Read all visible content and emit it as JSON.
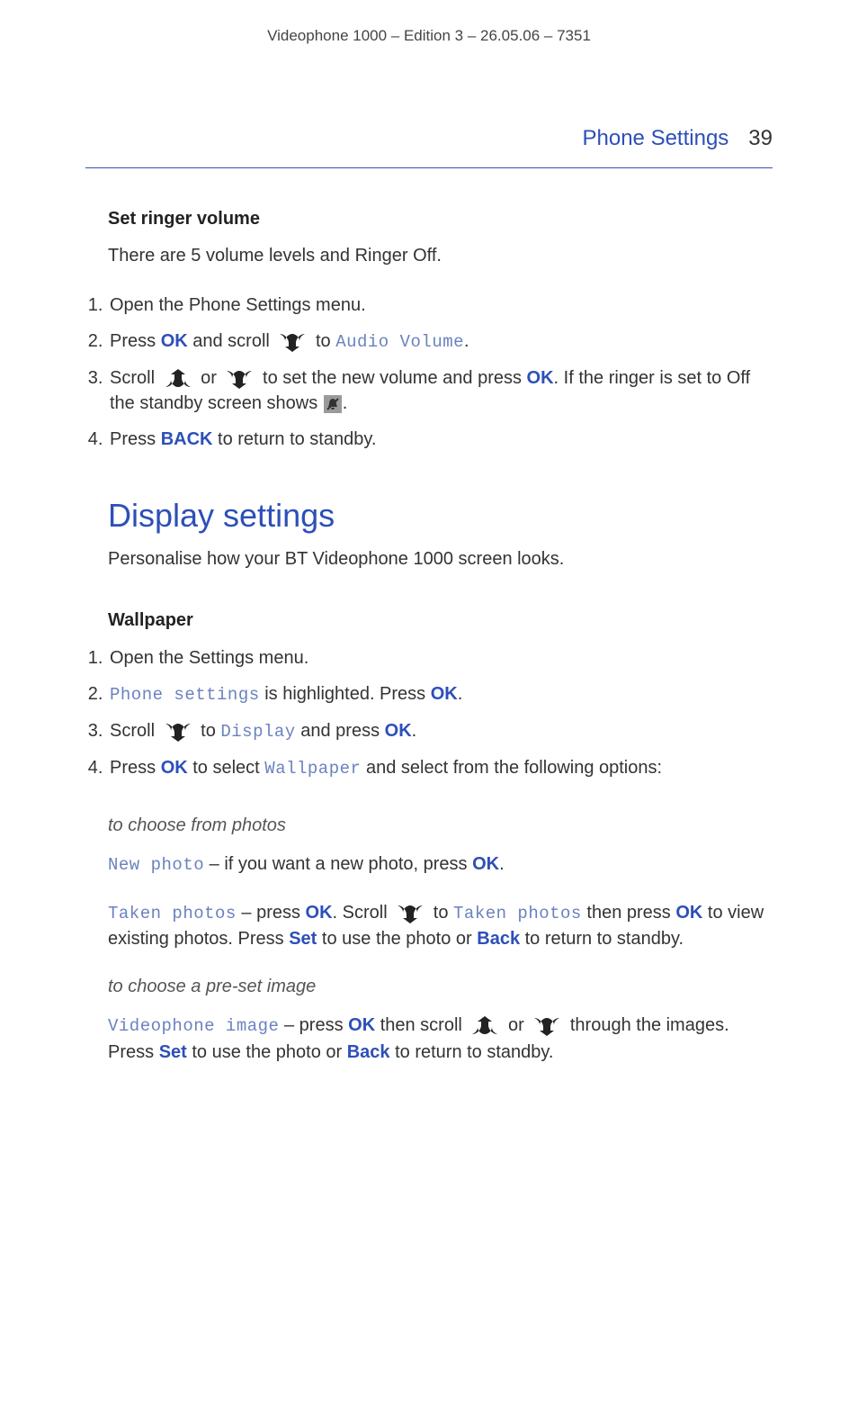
{
  "header": "Videophone 1000 – Edition 3 – 26.05.06 – 7351",
  "sectionHeader": {
    "title": "Phone Settings",
    "pageNum": "39"
  },
  "s1": {
    "heading": "Set ringer volume",
    "intro": "There are 5 volume levels and Ringer Off.",
    "steps": [
      {
        "parts": [
          {
            "t": "text",
            "v": "Open the Phone Settings menu."
          }
        ]
      },
      {
        "parts": [
          {
            "t": "text",
            "v": "Press "
          },
          {
            "t": "bb",
            "v": "OK"
          },
          {
            "t": "text",
            "v": " and scroll "
          },
          {
            "t": "icon",
            "v": "down"
          },
          {
            "t": "text",
            "v": " to "
          },
          {
            "t": "lcd",
            "v": "Audio Volume"
          },
          {
            "t": "text",
            "v": "."
          }
        ]
      },
      {
        "parts": [
          {
            "t": "text",
            "v": "Scroll "
          },
          {
            "t": "icon",
            "v": "up"
          },
          {
            "t": "text",
            "v": " or "
          },
          {
            "t": "icon",
            "v": "down"
          },
          {
            "t": "text",
            "v": " to set the new volume and press "
          },
          {
            "t": "bb",
            "v": "OK"
          },
          {
            "t": "text",
            "v": ". If the ringer is set to Off the standby screen shows "
          },
          {
            "t": "icon",
            "v": "mute"
          },
          {
            "t": "text",
            "v": "."
          }
        ]
      },
      {
        "parts": [
          {
            "t": "text",
            "v": "Press "
          },
          {
            "t": "bb",
            "v": "BACK"
          },
          {
            "t": "text",
            "v": " to return to standby."
          }
        ]
      }
    ]
  },
  "s2": {
    "h2": "Display settings",
    "intro": "Personalise how your BT Videophone 1000 screen looks.",
    "heading": "Wallpaper",
    "steps": [
      {
        "parts": [
          {
            "t": "text",
            "v": "Open the Settings menu."
          }
        ]
      },
      {
        "parts": [
          {
            "t": "lcd",
            "v": "Phone settings"
          },
          {
            "t": "text",
            "v": " is highlighted. Press "
          },
          {
            "t": "bb",
            "v": "OK"
          },
          {
            "t": "text",
            "v": "."
          }
        ]
      },
      {
        "parts": [
          {
            "t": "text",
            "v": "Scroll "
          },
          {
            "t": "icon",
            "v": "down"
          },
          {
            "t": "text",
            "v": " to "
          },
          {
            "t": "lcd",
            "v": "Display"
          },
          {
            "t": "text",
            "v": " and press "
          },
          {
            "t": "bb",
            "v": "OK"
          },
          {
            "t": "text",
            "v": "."
          }
        ]
      },
      {
        "parts": [
          {
            "t": "text",
            "v": "Press "
          },
          {
            "t": "bb",
            "v": "OK"
          },
          {
            "t": "text",
            "v": " to select "
          },
          {
            "t": "lcd",
            "v": "Wallpaper"
          },
          {
            "t": "text",
            "v": " and select from the following options:"
          }
        ]
      }
    ],
    "sub": [
      {
        "type": "italic",
        "parts": [
          {
            "t": "text",
            "v": "to choose from photos"
          }
        ]
      },
      {
        "type": "para",
        "parts": [
          {
            "t": "lcd",
            "v": "New photo"
          },
          {
            "t": "text",
            "v": " – if you want a new photo, press "
          },
          {
            "t": "bb",
            "v": "OK"
          },
          {
            "t": "text",
            "v": "."
          }
        ]
      },
      {
        "type": "para",
        "parts": [
          {
            "t": "lcd",
            "v": "Taken photos"
          },
          {
            "t": "text",
            "v": " – press "
          },
          {
            "t": "bb",
            "v": "OK"
          },
          {
            "t": "text",
            "v": ". Scroll "
          },
          {
            "t": "icon",
            "v": "down"
          },
          {
            "t": "text",
            "v": " to "
          },
          {
            "t": "lcd",
            "v": "Taken photos"
          },
          {
            "t": "text",
            "v": " then press "
          },
          {
            "t": "bb",
            "v": "OK"
          },
          {
            "t": "text",
            "v": " to view existing photos. Press "
          },
          {
            "t": "bb",
            "v": "Set"
          },
          {
            "t": "text",
            "v": " to use the photo or "
          },
          {
            "t": "bb",
            "v": "Back"
          },
          {
            "t": "text",
            "v": " to return to standby."
          }
        ]
      },
      {
        "type": "italic",
        "parts": [
          {
            "t": "text",
            "v": "to choose a pre-set image"
          }
        ]
      },
      {
        "type": "para",
        "parts": [
          {
            "t": "lcd",
            "v": "Videophone image"
          },
          {
            "t": "text",
            "v": " – press "
          },
          {
            "t": "bb",
            "v": "OK"
          },
          {
            "t": "text",
            "v": " then scroll "
          },
          {
            "t": "icon",
            "v": "up"
          },
          {
            "t": "text",
            "v": " or "
          },
          {
            "t": "icon",
            "v": "down"
          },
          {
            "t": "text",
            "v": " through the images. Press "
          },
          {
            "t": "bb",
            "v": "Set"
          },
          {
            "t": "text",
            "v": " to use the photo or "
          },
          {
            "t": "bb",
            "v": "Back"
          },
          {
            "t": "text",
            "v": " to return to standby."
          }
        ]
      }
    ]
  }
}
